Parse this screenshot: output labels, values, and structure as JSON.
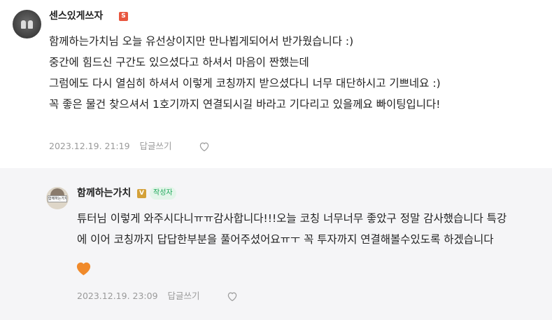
{
  "comment": {
    "author": "센스있게쓰자",
    "author_badge": "S",
    "lines": [
      "함께하는가치님 오늘 유선상이지만 만나뵙게되어서 반가웠습니다 :)",
      "중간에 힘드신 구간도 있으셨다고 하셔서 마음이 짠했는데",
      "그럼에도 다시 열심히 하셔서 이렇게 코칭까지 받으셨다니 너무 대단하시고 기쁘네요 :)",
      "꼭 좋은 물건 찾으셔서 1호기까지 연결되시길 바라고 기다리고 있을께요 빠이팅입니다!"
    ],
    "date": "2023.12.19. 21:19",
    "reply_label": "답글쓰기",
    "like_icon": "heart-outline-icon"
  },
  "reply": {
    "author": "함께하는가치",
    "author_badge": "V",
    "author_tag": "작성자",
    "avatar_text": "함께하는가치",
    "lines": [
      "튜터님 이렇게 와주시다니ㅠㅠ감사합니다!!!오늘 코칭 너무너무 좋았구 정말 감사했습니다 특강",
      "에 이어 코칭까지 답답한부분을 풀어주셨어요ㅠㅜ 꼭 투자까지 연결해볼수있도록 하겠습니다"
    ],
    "emoji": "🧡",
    "date": "2023.12.19. 23:09",
    "reply_label": "답글쓰기",
    "like_icon": "heart-outline-icon"
  },
  "colors": {
    "reply_background": "#f5f5f7",
    "badge_s": "#e8563f",
    "badge_v": "#d4a13a",
    "author_tag_text": "#1ea85a",
    "meta_text": "#9a9a9a"
  }
}
